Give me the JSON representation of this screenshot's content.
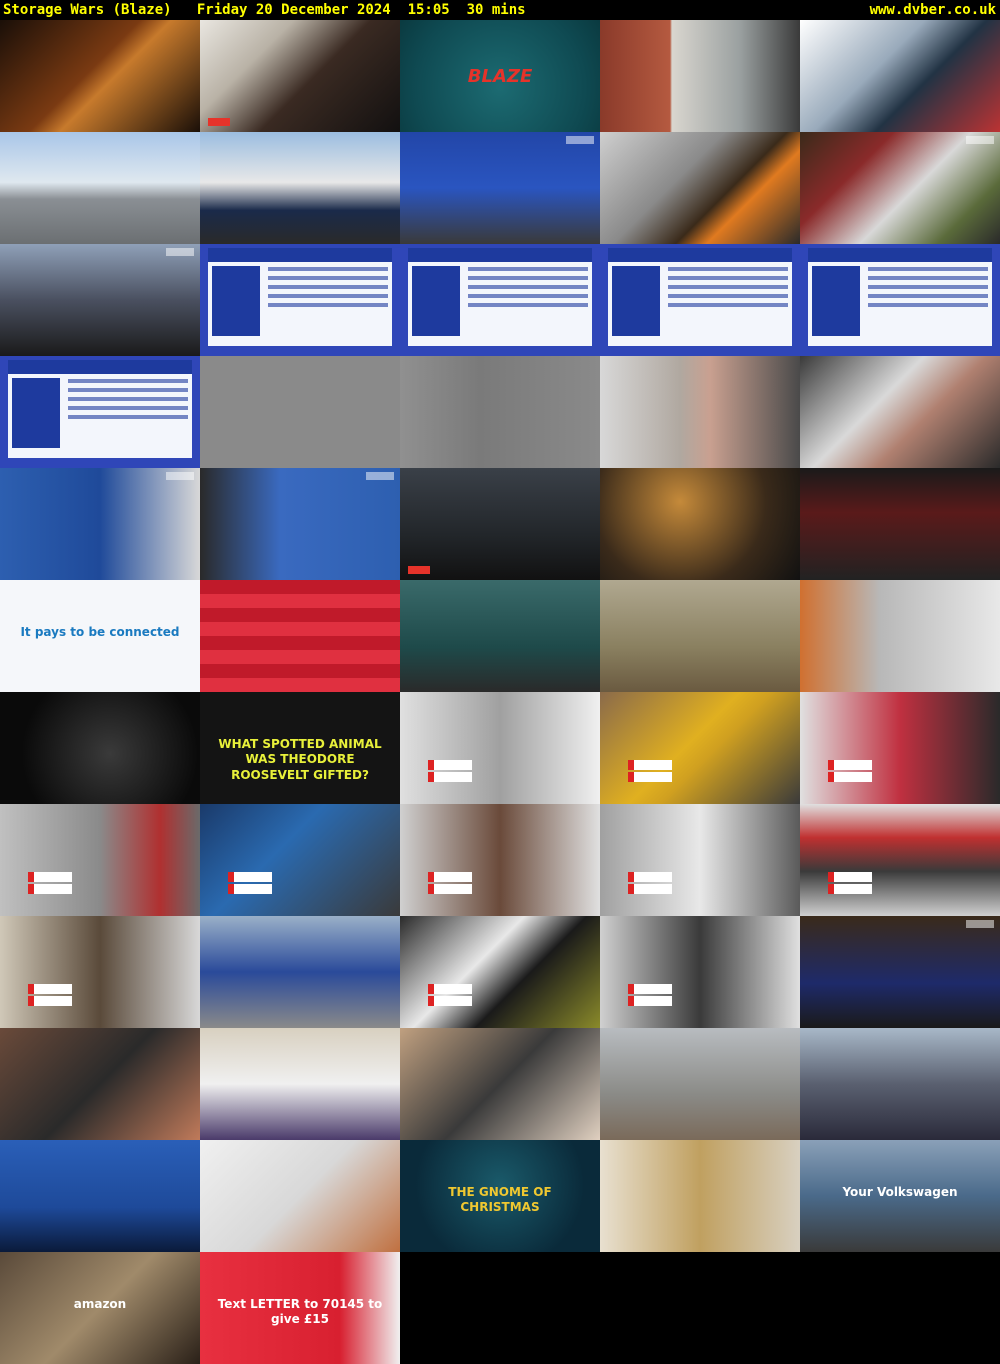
{
  "header": {
    "title": "Storage Wars (Blaze)   Friday 20 December 2024  15:05  30 mins",
    "site": "www.dvber.co.uk"
  },
  "thumbnails": [
    {
      "bg": "linear-gradient(135deg,#1a0f08,#7a3a12 45%,#c77a2c 55%,#1a0f08)",
      "kind": "plain"
    },
    {
      "bg": "linear-gradient(135deg,#e9e6e0 0%,#b9b2a6 30%,#3a2a22 55%,#121010 100%)",
      "kind": "blaze"
    },
    {
      "bg": "radial-gradient(circle at 50% 60%,#1c6b72,#0f4a52 70%,#0a3a40)",
      "kind": "blaze-logo",
      "text": "BLAZE"
    },
    {
      "bg": "linear-gradient(90deg,#8a3a2a 0%,#b55a40 35%,#d9d6cf 36%,#9aa0a0 70%,#3a3a3a 100%)",
      "kind": "plain"
    },
    {
      "bg": "linear-gradient(135deg,#ffffff,#9ab 40%,#234 60%,#b33 100%)",
      "kind": "plain"
    },
    {
      "bg": "linear-gradient(180deg,#a9c6e8 0%,#dfe8ef 45%,#8a8f94 60%,#6b6f72 100%)",
      "kind": "plain"
    },
    {
      "bg": "linear-gradient(180deg,#9bbde0 0%,#e8e8e8 45%,#1a2a4a 70%,#2a2a2a 100%)",
      "kind": "plain"
    },
    {
      "bg": "linear-gradient(180deg,#2246a8 0%,#2a55c0 50%,#3a3a3a 100%)",
      "kind": "corner"
    },
    {
      "bg": "linear-gradient(135deg,#cfcfcf,#8a8a8a 40%,#3a2a1a 60%,#e07a20 70%,#2a2a2a)",
      "kind": "plain"
    },
    {
      "bg": "linear-gradient(135deg,#3a2a1a,#8a2a2a 30%,#d8d8d8 55%,#5a6a3a 80%,#2a2a2a)",
      "kind": "corner"
    },
    {
      "bg": "linear-gradient(180deg,#8fa0b8 0%,#4a5060 50%,#1a1a1a 100%)",
      "kind": "corner"
    },
    {
      "bg": "#2f46b8",
      "kind": "ad"
    },
    {
      "bg": "#2f46b8",
      "kind": "ad"
    },
    {
      "bg": "#2f46b8",
      "kind": "ad"
    },
    {
      "bg": "#2f46b8",
      "kind": "ad"
    },
    {
      "bg": "#2f46b8",
      "kind": "ad"
    },
    {
      "bg": "#8a8a8a",
      "kind": "plain"
    },
    {
      "bg": "linear-gradient(90deg,#909090,#7a7a7a 40%,#8a8a8a)",
      "kind": "plain"
    },
    {
      "bg": "linear-gradient(90deg,#d8d8d8 0%,#b0a8a0 40%,#c9a090 55%,#4a4a4a 100%)",
      "kind": "plain"
    },
    {
      "bg": "linear-gradient(135deg,#3a3a3a,#d9d9d9 40%,#b08070 60%,#2a2a2a)",
      "kind": "plain"
    },
    {
      "bg": "linear-gradient(90deg,#2d5fb0 0%,#1f4a9a 50%,#d8d8d8 100%)",
      "kind": "corner"
    },
    {
      "bg": "linear-gradient(90deg,#2a2a2a 0%,#3a6ac0 40%,#2d5fb0 100%)",
      "kind": "corner"
    },
    {
      "bg": "linear-gradient(180deg,#3a4048,#22262a 60%,#111)",
      "kind": "blaze"
    },
    {
      "bg": "radial-gradient(circle at 40% 30%,#c58a3a,#3a2a1a 60%,#111)",
      "kind": "plain"
    },
    {
      "bg": "linear-gradient(180deg,#1a1a1a,#5a1a1a 40%,#222)",
      "kind": "plain"
    },
    {
      "bg": "#f5f7fa",
      "kind": "text",
      "text": "It pays to be connected",
      "color": "#1a7ac0"
    },
    {
      "bg": "repeating-linear-gradient(180deg,#c01a2a 0 14px,#e03040 14px 28px)",
      "kind": "plain"
    },
    {
      "bg": "linear-gradient(180deg,#3a6a6a,#1e4a4a 60%,#2a2a2a)",
      "kind": "plain"
    },
    {
      "bg": "linear-gradient(180deg,#b0a890,#8a8060 60%,#6a5a40)",
      "kind": "plain"
    },
    {
      "bg": "linear-gradient(90deg,#d07030,#b8b8b8 40%,#e8e8e8)",
      "kind": "plain"
    },
    {
      "bg": "radial-gradient(circle at 55% 55%,#3a3a3a,#0a0a0a 70%)",
      "kind": "plain"
    },
    {
      "bg": "#141414",
      "kind": "text",
      "text": "WHAT SPOTTED ANIMAL WAS THEODORE ROOSEVELT GIFTED?",
      "color": "#e8f03a"
    },
    {
      "bg": "linear-gradient(90deg,#e0e0e0,#a0a0a0 50%,#f0f0f0)",
      "kind": "value"
    },
    {
      "bg": "linear-gradient(135deg,#8a6a4a,#e0b020 45%,#d0a020 55%,#3a3a3a)",
      "kind": "value"
    },
    {
      "bg": "linear-gradient(90deg,#e0e0e0,#c03040 50%,#2a2a2a)",
      "kind": "value"
    },
    {
      "bg": "linear-gradient(90deg,#c0c0c0,#8a8a8a 50%,#b03030 80%,#6a6a6a)",
      "kind": "value"
    },
    {
      "bg": "linear-gradient(135deg,#1a3a6a,#2a6ab0 40%,#3a3a3a)",
      "kind": "value"
    },
    {
      "bg": "linear-gradient(90deg,#d0d0d0,#6a4a3a 50%,#e0e0e0)",
      "kind": "value"
    },
    {
      "bg": "linear-gradient(90deg,#a0a0a0,#e8e8e8 50%,#5a5a5a)",
      "kind": "value"
    },
    {
      "bg": "linear-gradient(180deg,#e0e0e0,#c03030 30%,#3a3a3a 60%,#d0d0d0)",
      "kind": "value"
    },
    {
      "bg": "linear-gradient(90deg,#d0c8b8,#5a4a3a 50%,#d8d8d8)",
      "kind": "value"
    },
    {
      "bg": "linear-gradient(180deg,#9ab0c8,#2a4a9a 50%,#8a8a8a)",
      "kind": "plain"
    },
    {
      "bg": "linear-gradient(135deg,#2a2a2a,#e8e8e8 40%,#1a1a1a 60%,#8a8a2a)",
      "kind": "value"
    },
    {
      "bg": "linear-gradient(90deg,#d0d0d0,#3a3a3a 50%,#e0e0e0)",
      "kind": "value"
    },
    {
      "bg": "linear-gradient(180deg,#3a2a1a,#1e2a6a 60%,#1a1a1a)",
      "kind": "corner"
    },
    {
      "bg": "linear-gradient(135deg,#6a4a3a,#2a2a2a 50%,#c07a5a)",
      "kind": "plain"
    },
    {
      "bg": "linear-gradient(180deg,#d8d0c0,#f0f0f0 50%,#4a3a6a)",
      "kind": "plain"
    },
    {
      "bg": "linear-gradient(135deg,#c0a080,#3a3a3a 50%,#e0d0c0)",
      "kind": "plain"
    },
    {
      "bg": "linear-gradient(180deg,#b8bcc0,#8a8a86 60%,#7a6a5a)",
      "kind": "plain"
    },
    {
      "bg": "linear-gradient(180deg,#a8b8c8,#5a6070 50%,#2a2a3a)",
      "kind": "plain"
    },
    {
      "bg": "linear-gradient(180deg,#2a5fb8,#1e4a9a 60%,#0a1a3a)",
      "kind": "plain"
    },
    {
      "bg": "linear-gradient(135deg,#f0f0f0,#d8d8d8 50%,#c07040)",
      "kind": "plain"
    },
    {
      "bg": "radial-gradient(circle at 50% 40%,#1a5a6a,#0a2a3a 70%)",
      "kind": "text",
      "text": "THE GNOME OF CHRISTMAS",
      "color": "#f0c830"
    },
    {
      "bg": "linear-gradient(90deg,#e8e0d0,#c0a060 50%,#d8d0c0)",
      "kind": "plain"
    },
    {
      "bg": "linear-gradient(180deg,#8aa0b8,#4a6a8a 50%,#3a3a3a)",
      "kind": "text",
      "text": "Your Volkswagen",
      "color": "#ffffff"
    },
    {
      "bg": "linear-gradient(135deg,#5a4a3a,#a08a6a 50%,#2a2018)",
      "kind": "text",
      "text": "amazon",
      "color": "#ffffff"
    },
    {
      "bg": "linear-gradient(90deg,#e83040,#d82030 70%,#f0f0f0)",
      "kind": "text",
      "text": "Text LETTER to 70145 to give £15",
      "color": "#ffffff"
    }
  ]
}
